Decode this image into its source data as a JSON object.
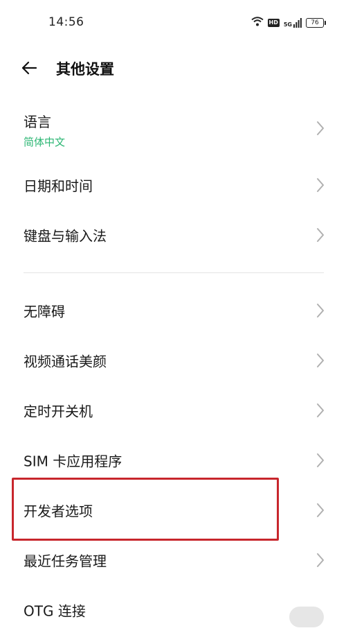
{
  "status": {
    "time": "14:56",
    "hd": "HD",
    "network": "5G",
    "battery": "76"
  },
  "header": {
    "title": "其他设置"
  },
  "items": [
    {
      "label": "语言",
      "sub": "简体中文"
    },
    {
      "label": "日期和时间"
    },
    {
      "label": "键盘与输入法"
    },
    {
      "label": "无障碍"
    },
    {
      "label": "视频通话美颜"
    },
    {
      "label": "定时开关机"
    },
    {
      "label": "SIM 卡应用程序"
    },
    {
      "label": "开发者选项"
    },
    {
      "label": "最近任务管理"
    },
    {
      "label": "OTG 连接"
    }
  ],
  "colors": {
    "accent": "#2bb673",
    "highlight": "#c8262c"
  }
}
